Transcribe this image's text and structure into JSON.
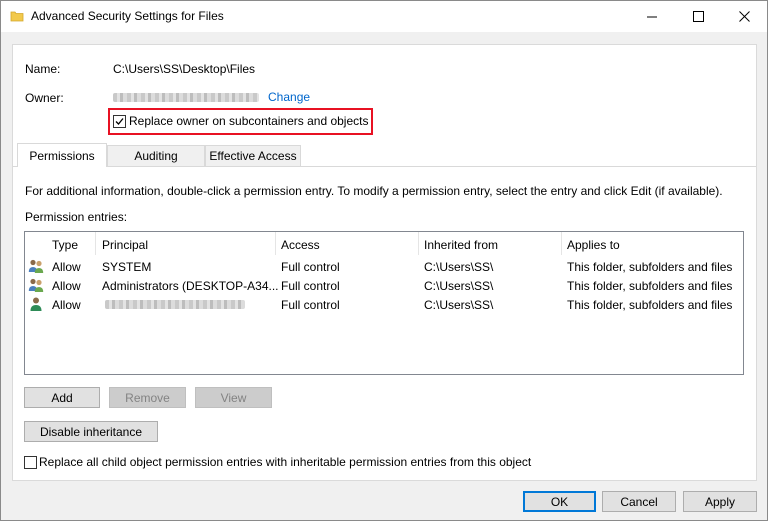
{
  "window": {
    "title": "Advanced Security Settings for Files",
    "controls": [
      "minimize",
      "maximize",
      "close"
    ]
  },
  "details": {
    "name_label": "Name:",
    "name_value": "C:\\Users\\SS\\Desktop\\Files",
    "owner_label": "Owner:",
    "change_link": "Change",
    "replace_owner_label": "Replace owner on subcontainers and objects",
    "replace_owner_checked": true
  },
  "tabs": [
    {
      "label": "Permissions",
      "active": true
    },
    {
      "label": "Auditing",
      "active": false
    },
    {
      "label": "Effective Access",
      "active": false
    }
  ],
  "info_text": "For additional information, double-click a permission entry. To modify a permission entry, select the entry and click Edit (if available).",
  "entries_label": "Permission entries:",
  "table": {
    "columns": [
      "Type",
      "Principal",
      "Access",
      "Inherited from",
      "Applies to"
    ],
    "rows": [
      {
        "icon": "group-users-icon",
        "type": "Allow",
        "principal": "SYSTEM",
        "access": "Full control",
        "inherited": "C:\\Users\\SS\\",
        "applies": "This folder, subfolders and files"
      },
      {
        "icon": "group-users-icon",
        "type": "Allow",
        "principal": "Administrators (DESKTOP-A34...",
        "access": "Full control",
        "inherited": "C:\\Users\\SS\\",
        "applies": "This folder, subfolders and files"
      },
      {
        "icon": "user-icon",
        "type": "Allow",
        "principal": "",
        "access": "Full control",
        "inherited": "C:\\Users\\SS\\",
        "applies": "This folder, subfolders and files"
      }
    ]
  },
  "buttons": {
    "add": "Add",
    "remove": "Remove",
    "view": "View",
    "disable_inheritance": "Disable inheritance",
    "ok": "OK",
    "cancel": "Cancel",
    "apply": "Apply"
  },
  "replace_child": {
    "label": "Replace all child object permission entries with inheritable permission entries from this object",
    "checked": false
  },
  "colors": {
    "link": "#0066cc",
    "highlight": "#e81123",
    "default_button_border": "#0078d7"
  }
}
